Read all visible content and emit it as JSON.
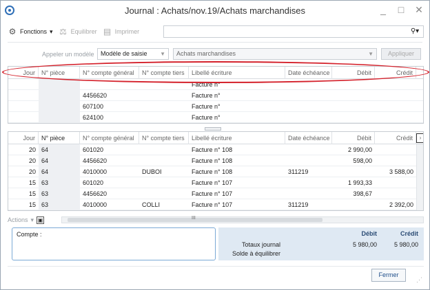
{
  "window": {
    "title": "Journal : Achats/nov.19/Achats marchandises",
    "minimize": "_",
    "maximize": "□",
    "close": "✕"
  },
  "toolbar": {
    "fonctions_label": "Fonctions",
    "equilibrer_label": "Equilibrer",
    "imprimer_label": "Imprimer",
    "search_value": ""
  },
  "model": {
    "label": "Appeler un modèle",
    "selected": "Modèle de saisie",
    "journal_selected": "Achats marchandises",
    "apply_label": "Appliquer"
  },
  "columns": [
    "Jour",
    "N° pièce",
    "N° compte général",
    "N° compte tiers",
    "Libellé écriture",
    "Date échéance",
    "Débit",
    "Crédit"
  ],
  "model_grid": {
    "rows": [
      {
        "jour": "",
        "piece": "",
        "general": "",
        "tiers": "",
        "libelle": "Facture n°",
        "echeance": "",
        "debit": "",
        "credit": ""
      },
      {
        "jour": "",
        "piece": "",
        "general": "4456620",
        "tiers": "",
        "libelle": "Facture n°",
        "echeance": "",
        "debit": "",
        "credit": ""
      },
      {
        "jour": "",
        "piece": "",
        "general": "607100",
        "tiers": "",
        "libelle": "Facture n°",
        "echeance": "",
        "debit": "",
        "credit": ""
      },
      {
        "jour": "",
        "piece": "",
        "general": "624100",
        "tiers": "",
        "libelle": "Facture n°",
        "echeance": "",
        "debit": "",
        "credit": ""
      }
    ]
  },
  "entries_grid": {
    "rows": [
      {
        "jour": "20",
        "piece": "64",
        "general": "601020",
        "tiers": "",
        "libelle": "Facture n° 108",
        "echeance": "",
        "debit": "2 990,00",
        "credit": ""
      },
      {
        "jour": "20",
        "piece": "64",
        "general": "4456620",
        "tiers": "",
        "libelle": "Facture n° 108",
        "echeance": "",
        "debit": "598,00",
        "credit": ""
      },
      {
        "jour": "20",
        "piece": "64",
        "general": "4010000",
        "tiers": "DUBOI",
        "libelle": "Facture n° 108",
        "echeance": "311219",
        "debit": "",
        "credit": "3 588,00"
      },
      {
        "jour": "15",
        "piece": "63",
        "general": "601020",
        "tiers": "",
        "libelle": "Facture n° 107",
        "echeance": "",
        "debit": "1 993,33",
        "credit": ""
      },
      {
        "jour": "15",
        "piece": "63",
        "general": "4456620",
        "tiers": "",
        "libelle": "Facture n° 107",
        "echeance": "",
        "debit": "398,67",
        "credit": ""
      },
      {
        "jour": "15",
        "piece": "63",
        "general": "4010000",
        "tiers": "COLLI",
        "libelle": "Facture n° 107",
        "echeance": "311219",
        "debit": "",
        "credit": "2 392,00"
      }
    ]
  },
  "actions": {
    "label": "Actions",
    "scroll_mark": "III"
  },
  "bottom": {
    "compte_label": "Compte :",
    "debit_header": "Débit",
    "credit_header": "Crédit",
    "totaux_label": "Totaux journal",
    "solde_label": "Solde à équilibrer",
    "total_debit": "5 980,00",
    "total_credit": "5 980,00"
  },
  "footer": {
    "fermer_label": "Fermer"
  },
  "colors": {
    "accent": "#2f6fb7",
    "highlight_oval": "#d4202a",
    "selected_row": "#cfe4f7"
  }
}
